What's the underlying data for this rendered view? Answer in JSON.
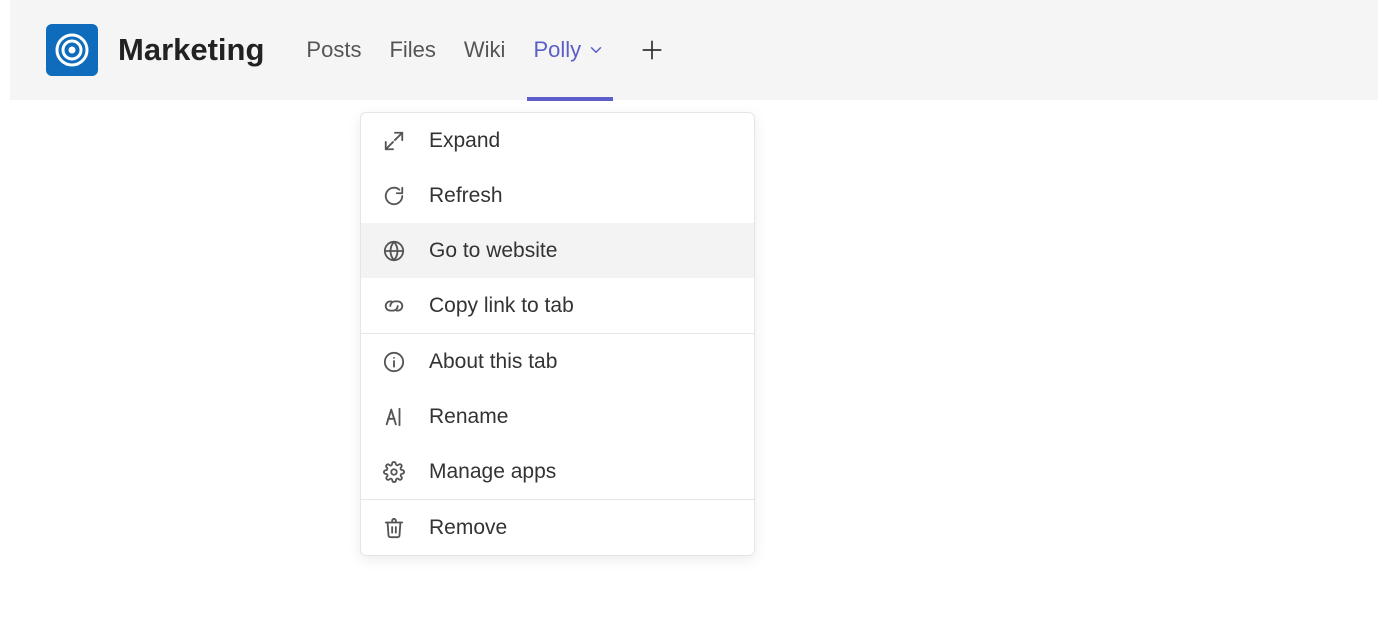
{
  "header": {
    "channel_title": "Marketing",
    "tabs": [
      {
        "label": "Posts"
      },
      {
        "label": "Files"
      },
      {
        "label": "Wiki"
      },
      {
        "label": "Polly"
      }
    ]
  },
  "context_menu": {
    "items": [
      {
        "label": "Expand",
        "icon": "expand-icon"
      },
      {
        "label": "Refresh",
        "icon": "refresh-icon"
      },
      {
        "label": "Go to website",
        "icon": "globe-icon",
        "hovered": true
      },
      {
        "label": "Copy link to tab",
        "icon": "link-icon"
      }
    ],
    "group2": [
      {
        "label": "About this tab",
        "icon": "info-icon"
      },
      {
        "label": "Rename",
        "icon": "rename-icon"
      },
      {
        "label": "Manage apps",
        "icon": "gear-icon"
      }
    ],
    "group3": [
      {
        "label": "Remove",
        "icon": "trash-icon"
      }
    ]
  }
}
